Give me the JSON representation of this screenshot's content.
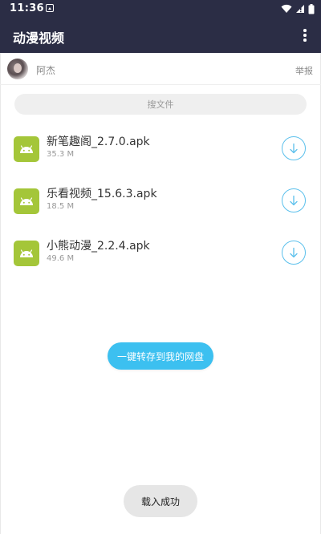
{
  "status_bar": {
    "time": "11:36"
  },
  "app_bar": {
    "title": "动漫视频"
  },
  "user": {
    "name": "阿杰",
    "report_label": "举报"
  },
  "search": {
    "placeholder": "搜文件"
  },
  "files": [
    {
      "name": "新笔趣阁_2.7.0.apk",
      "size": "35.3 M"
    },
    {
      "name": "乐看视频_15.6.3.apk",
      "size": "18.5 M"
    },
    {
      "name": "小熊动漫_2.2.4.apk",
      "size": "49.6 M"
    }
  ],
  "actions": {
    "save_to_disk": "一键转存到我的网盘"
  },
  "toast": {
    "message": "载入成功"
  },
  "colors": {
    "header_bg": "#2b2d45",
    "accent": "#3cc0f0",
    "android_green": "#a4c639"
  }
}
